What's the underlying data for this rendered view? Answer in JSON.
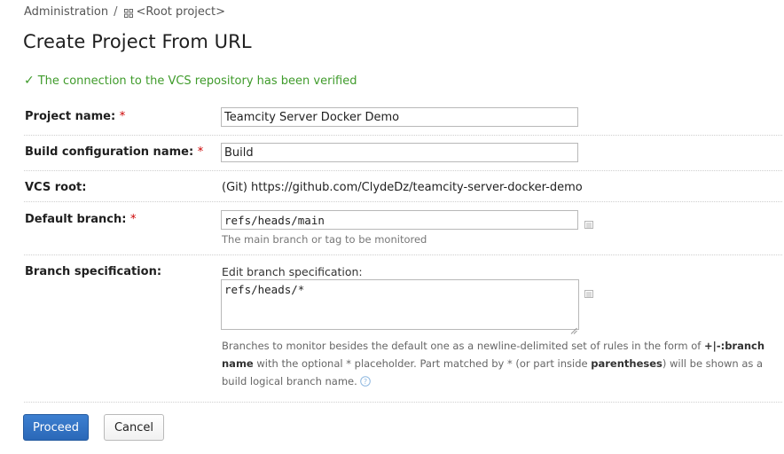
{
  "breadcrumb": {
    "administration": "Administration",
    "separator": "/",
    "root_icon": "grid-icon",
    "root_project": "<Root project>"
  },
  "page_title": "Create Project From URL",
  "verification": {
    "icon": "checkmark-icon",
    "message": "The connection to the VCS repository has been verified",
    "color": "#3f9b2b"
  },
  "form": {
    "project_name": {
      "label": "Project name:",
      "required_mark": "*",
      "value": "Teamcity Server Docker Demo"
    },
    "build_config_name": {
      "label": "Build configuration name:",
      "required_mark": "*",
      "value": "Build"
    },
    "vcs_root": {
      "label": "VCS root:",
      "value": "(Git) https://github.com/ClydeDz/teamcity-server-docker-demo"
    },
    "default_branch": {
      "label": "Default branch:",
      "required_mark": "*",
      "value": "refs/heads/main",
      "hint": "The main branch or tag to be monitored",
      "icon": "list-icon"
    },
    "branch_spec": {
      "label": "Branch specification:",
      "edit_label": "Edit branch specification:",
      "value": "refs/heads/*",
      "icon": "list-icon",
      "help": {
        "part1": "Branches to monitor besides the default one as a newline-delimited set of rules in the form of ",
        "rule_syntax": "+|-:branch name",
        "part2": " with the optional * placeholder. Part matched by * (or part inside ",
        "parentheses": "parentheses",
        "part3": ") will be shown as a build logical branch name.",
        "help_icon": "question-circle-icon"
      }
    }
  },
  "buttons": {
    "proceed": "Proceed",
    "cancel": "Cancel"
  },
  "colors": {
    "primary_button": "#2a68b8",
    "required": "#cc0000"
  }
}
